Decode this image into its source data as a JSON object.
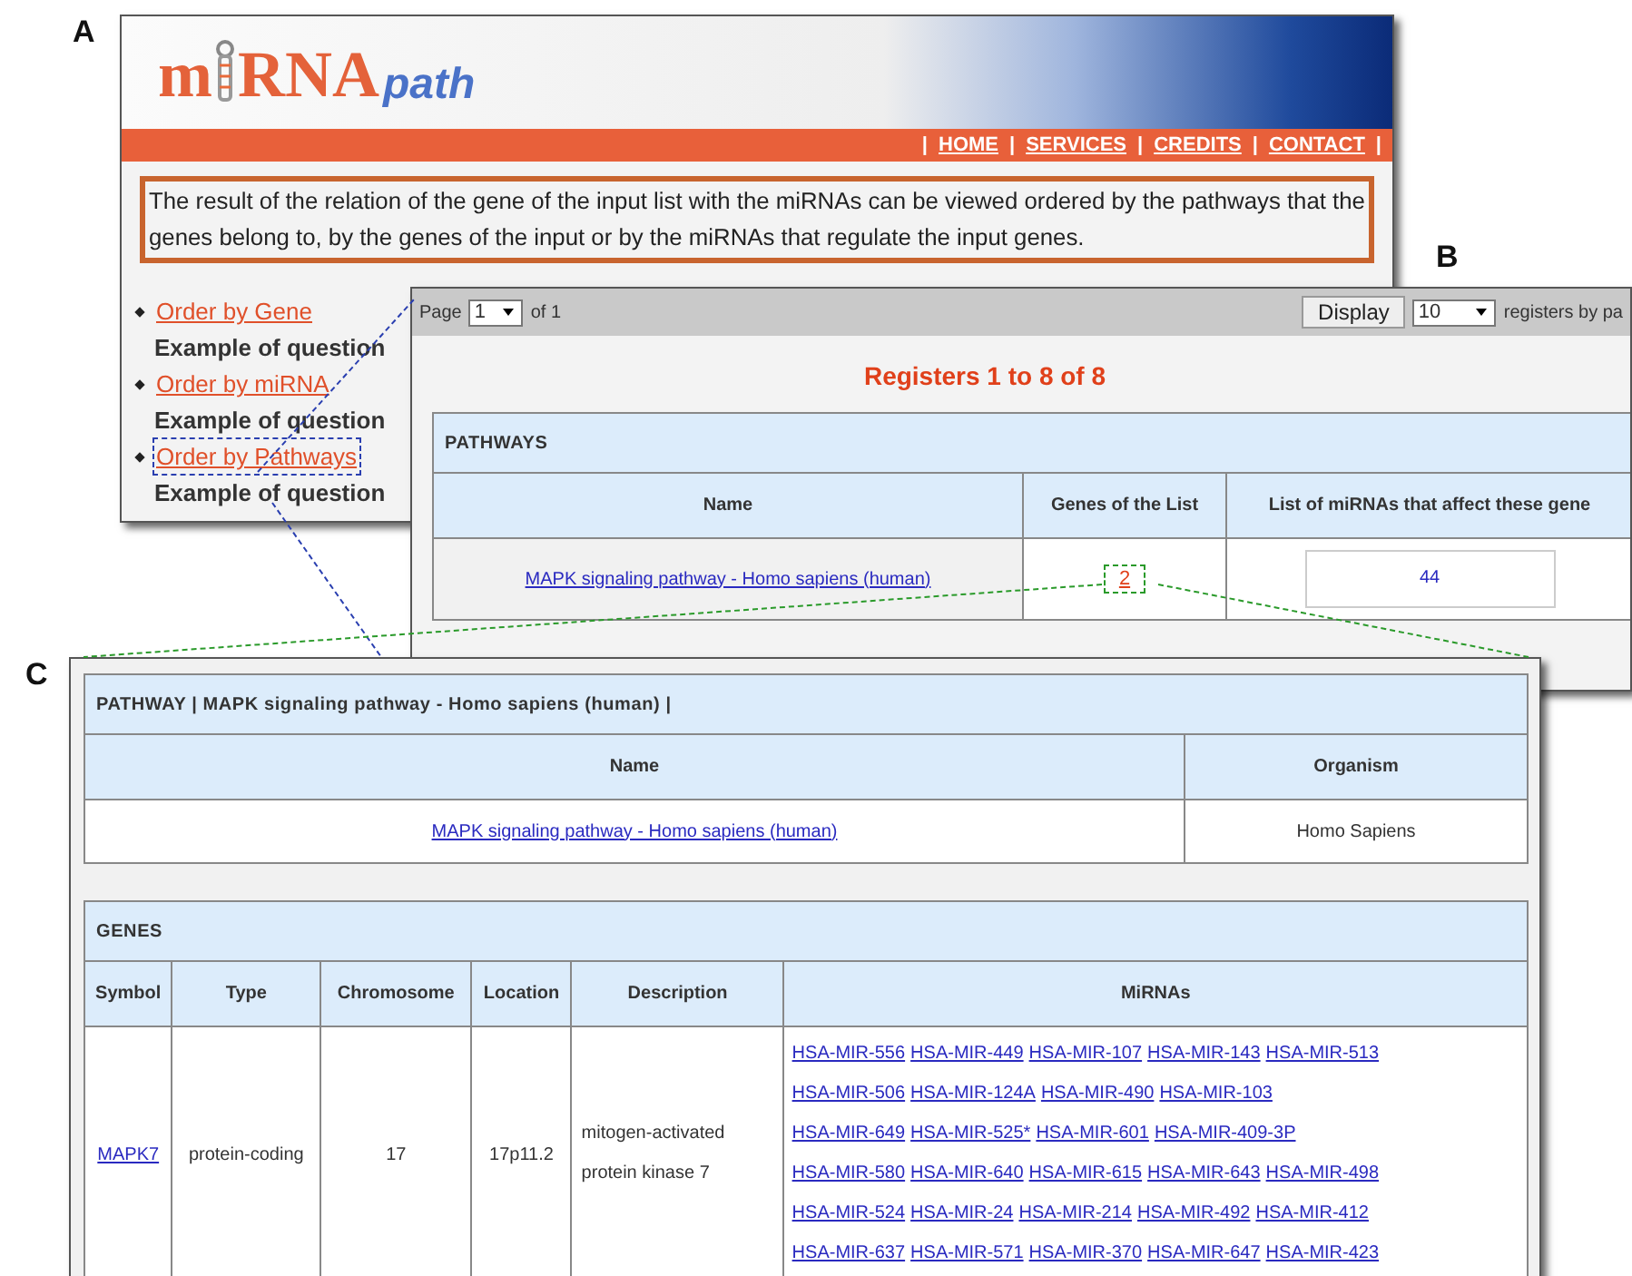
{
  "panel_a": {
    "label": "A",
    "logo": {
      "left": "m",
      "right": "RNA",
      "suffix": "path"
    },
    "nav": [
      {
        "kind": "separator",
        "text": "|"
      },
      {
        "kind": "link",
        "text": "HOME"
      },
      {
        "kind": "separator",
        "text": "|"
      },
      {
        "kind": "link",
        "text": "SERVICES"
      },
      {
        "kind": "separator",
        "text": "|"
      },
      {
        "kind": "link",
        "text": "CREDITS"
      },
      {
        "kind": "separator",
        "text": "|"
      },
      {
        "kind": "link",
        "text": "CONTACT"
      },
      {
        "kind": "separator",
        "text": "|"
      }
    ],
    "description": "The result of the relation of the gene of the input list with the miRNAs can be viewed ordered by the pathways that the  genes  belong to, by the genes of the input or by the miRNAs  that  regulate  the input genes.",
    "options": [
      {
        "link": "Order by Gene",
        "example": "Example of question",
        "highlighted": false
      },
      {
        "link": "Order by miRNA",
        "example": "Example of question",
        "highlighted": false
      },
      {
        "link": "Order by Pathways",
        "example": "Example of question",
        "highlighted": true
      }
    ]
  },
  "panel_b": {
    "label": "B",
    "toolbar": {
      "page_label": "Page",
      "page_select": "1",
      "page_count": "of 1",
      "display_button": "Display",
      "per_page_select": "10",
      "per_page_label": "registers by pa"
    },
    "title": "Registers 1 to 8 of 8",
    "table": {
      "caption": "PATHWAYS",
      "columns": [
        "Name",
        "Genes of the List",
        "List of miRNAs that affect these gene"
      ],
      "rows": [
        {
          "name": "MAPK signaling pathway - Homo sapiens (human)",
          "genes": "2",
          "mirnas": "44",
          "highlighted": true
        }
      ]
    }
  },
  "panel_c": {
    "label": "C",
    "pathway_table": {
      "caption": "PATHWAY | MAPK signaling pathway - Homo sapiens (human) |",
      "columns": [
        "Name",
        "Organism"
      ],
      "rows": [
        {
          "name": "MAPK signaling pathway - Homo sapiens (human)",
          "organism": "Homo Sapiens"
        }
      ]
    },
    "genes_table": {
      "caption": "GENES",
      "columns": [
        "Symbol",
        "Type",
        "Chromosome",
        "Location",
        "Description",
        "MiRNAs"
      ],
      "rows": [
        {
          "symbol": "MAPK7",
          "type": "protein-coding",
          "chromosome": "17",
          "location": "17p11.2",
          "description": "mitogen-activated protein kinase 7",
          "mirna_lines": [
            [
              "HSA-MIR-556",
              "HSA-MIR-449",
              "HSA-MIR-107",
              "HSA-MIR-143",
              "HSA-MIR-513"
            ],
            [
              "HSA-MIR-506",
              "HSA-MIR-124A",
              "HSA-MIR-490",
              "HSA-MIR-103"
            ],
            [
              "HSA-MIR-649",
              "HSA-MIR-525*",
              "HSA-MIR-601",
              "HSA-MIR-409-3P"
            ],
            [
              "HSA-MIR-580",
              "HSA-MIR-640",
              "HSA-MIR-615",
              "HSA-MIR-643",
              "HSA-MIR-498"
            ],
            [
              "HSA-MIR-524",
              "HSA-MIR-24",
              "HSA-MIR-214",
              "HSA-MIR-492",
              "HSA-MIR-412"
            ],
            [
              "HSA-MIR-637",
              "HSA-MIR-571",
              "HSA-MIR-370",
              "HSA-MIR-647",
              "HSA-MIR-423"
            ]
          ]
        }
      ]
    }
  }
}
